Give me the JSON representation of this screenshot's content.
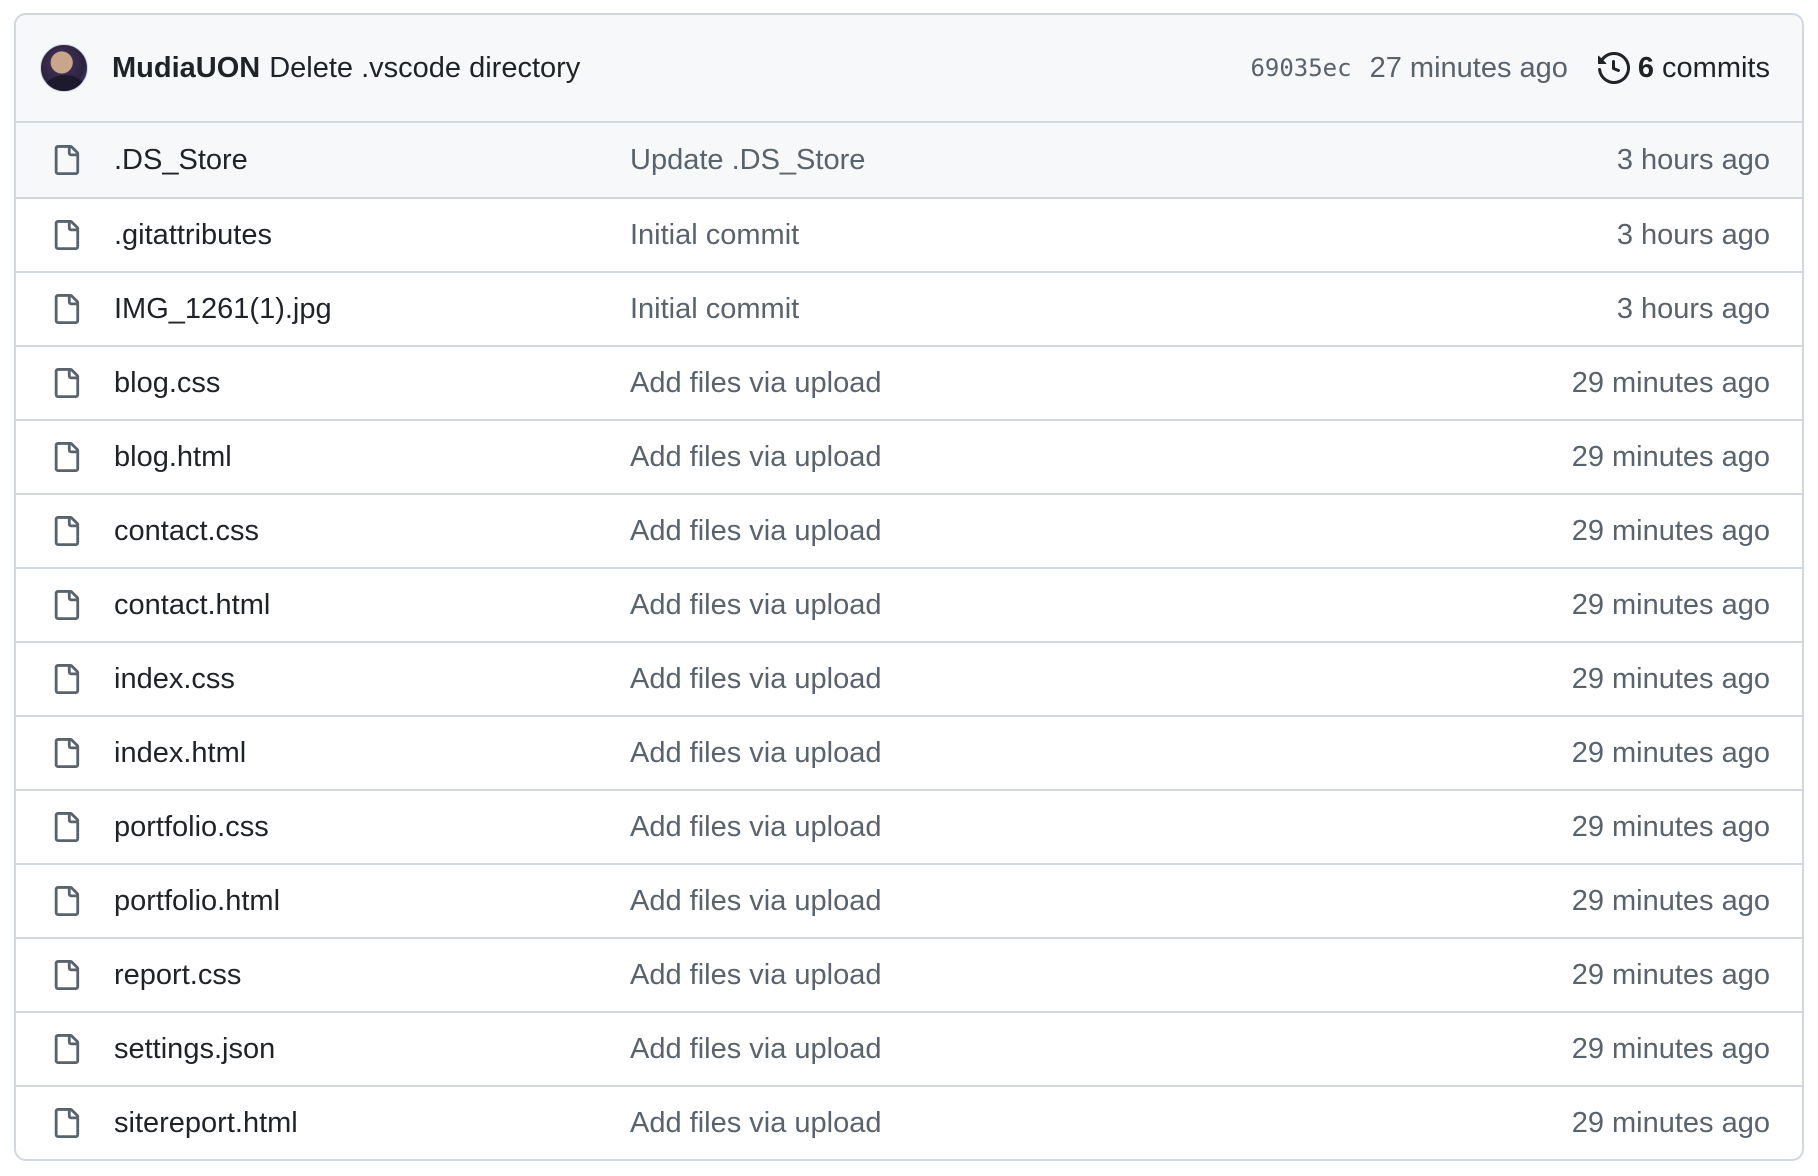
{
  "latest_commit": {
    "author": "MudiaUON",
    "message": "Delete .vscode directory",
    "sha": "69035ec",
    "time": "27 minutes ago",
    "history_icon": "history-icon",
    "commit_count": "6",
    "commit_word": "commits"
  },
  "file_icon": "file-icon",
  "files": [
    {
      "name": ".DS_Store",
      "commit": "Update .DS_Store",
      "age": "3 hours ago"
    },
    {
      "name": ".gitattributes",
      "commit": "Initial commit",
      "age": "3 hours ago"
    },
    {
      "name": "IMG_1261(1).jpg",
      "commit": "Initial commit",
      "age": "3 hours ago"
    },
    {
      "name": "blog.css",
      "commit": "Add files via upload",
      "age": "29 minutes ago"
    },
    {
      "name": "blog.html",
      "commit": "Add files via upload",
      "age": "29 minutes ago"
    },
    {
      "name": "contact.css",
      "commit": "Add files via upload",
      "age": "29 minutes ago"
    },
    {
      "name": "contact.html",
      "commit": "Add files via upload",
      "age": "29 minutes ago"
    },
    {
      "name": "index.css",
      "commit": "Add files via upload",
      "age": "29 minutes ago"
    },
    {
      "name": "index.html",
      "commit": "Add files via upload",
      "age": "29 minutes ago"
    },
    {
      "name": "portfolio.css",
      "commit": "Add files via upload",
      "age": "29 minutes ago"
    },
    {
      "name": "portfolio.html",
      "commit": "Add files via upload",
      "age": "29 minutes ago"
    },
    {
      "name": "report.css",
      "commit": "Add files via upload",
      "age": "29 minutes ago"
    },
    {
      "name": "settings.json",
      "commit": "Add files via upload",
      "age": "29 minutes ago"
    },
    {
      "name": "sitereport.html",
      "commit": "Add files via upload",
      "age": "29 minutes ago"
    }
  ],
  "colors": {
    "border": "#d0d7de",
    "header_bg": "#f6f8fa",
    "text": "#1f2328",
    "muted": "#59636e"
  }
}
